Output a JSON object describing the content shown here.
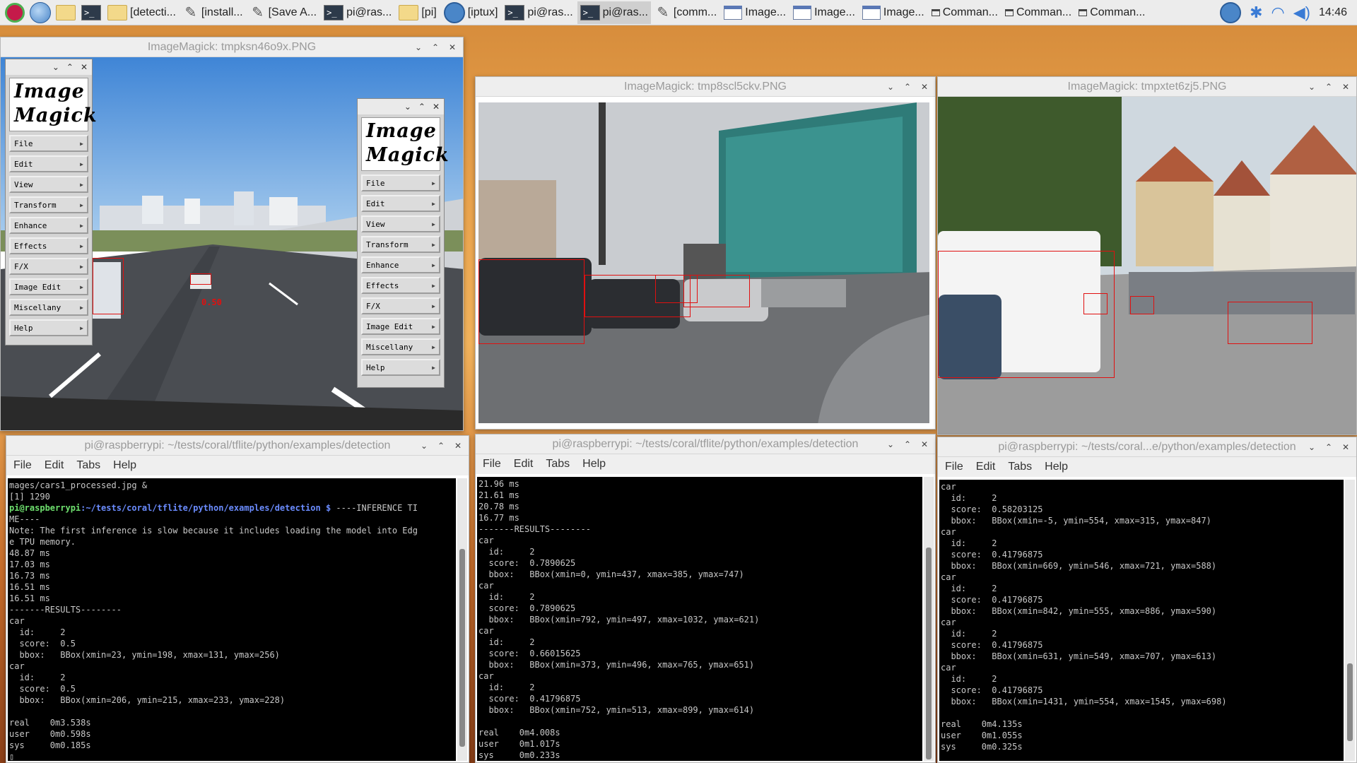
{
  "taskbar": {
    "tasks": [
      {
        "label": "[detecti...",
        "icon": "folder-icon"
      },
      {
        "label": "[install...",
        "icon": "pencil-icon"
      },
      {
        "label": "[Save A...",
        "icon": "pencil-icon"
      },
      {
        "label": "pi@ras...",
        "icon": "terminal-icon"
      },
      {
        "label": "[pi]",
        "icon": "folder-icon"
      },
      {
        "label": "[iptux]",
        "icon": "iptux-icon"
      },
      {
        "label": "pi@ras...",
        "icon": "terminal-icon"
      },
      {
        "label": "pi@ras...",
        "icon": "terminal-icon",
        "active": true
      },
      {
        "label": "[comm...",
        "icon": "pencil-icon"
      },
      {
        "label": "Image...",
        "icon": "window-icon"
      },
      {
        "label": "Image...",
        "icon": "window-icon"
      },
      {
        "label": "Image...",
        "icon": "window-icon"
      },
      {
        "label": "Comman...",
        "icon": "window-small-icon"
      },
      {
        "label": "Comman...",
        "icon": "window-small-icon"
      },
      {
        "label": "Comman...",
        "icon": "window-small-icon"
      }
    ],
    "clock": "14:46"
  },
  "image_windows": [
    {
      "title": "ImageMagick: tmpksn46o9x.PNG",
      "scores": [
        "0.50"
      ]
    },
    {
      "title": "ImageMagick: tmp8scl5ckv.PNG"
    },
    {
      "title": "ImageMagick: tmpxtet6zj5.PNG"
    }
  ],
  "imagemagick_menu": {
    "logo_line1": "Image",
    "logo_line2": "Magick",
    "buttons": [
      "File",
      "Edit",
      "View",
      "Transform",
      "Enhance",
      "Effects",
      "F/X",
      "Image Edit",
      "Miscellany",
      "Help"
    ]
  },
  "terminal_menu": [
    "File",
    "Edit",
    "Tabs",
    "Help"
  ],
  "terminals": [
    {
      "title": "pi@raspberrypi: ~/tests/coral/tflite/python/examples/detection",
      "prompt_user": "pi@raspberrypi",
      "prompt_path": ":~/tests/coral/tflite/python/examples/detection $",
      "prompt_rest": " ----INFERENCE TI",
      "lines_before": [
        "mages/cars1_processed.jpg &",
        "[1] 1290"
      ],
      "lines_after": [
        "ME----",
        "Note: The first inference is slow because it includes loading the model into Edg",
        "e TPU memory.",
        "48.87 ms",
        "17.03 ms",
        "16.73 ms",
        "16.51 ms",
        "16.51 ms",
        "-------RESULTS--------",
        "car",
        "  id:     2",
        "  score:  0.5",
        "  bbox:   BBox(xmin=23, ymin=198, xmax=131, ymax=256)",
        "car",
        "  id:     2",
        "  score:  0.5",
        "  bbox:   BBox(xmin=206, ymin=215, xmax=233, ymax=228)",
        "",
        "real    0m3.538s",
        "user    0m0.598s",
        "sys     0m0.185s",
        "▯"
      ]
    },
    {
      "title": "pi@raspberrypi: ~/tests/coral/tflite/python/examples/detection",
      "lines": [
        "21.96 ms",
        "21.61 ms",
        "20.78 ms",
        "16.77 ms",
        "-------RESULTS--------",
        "car",
        "  id:     2",
        "  score:  0.7890625",
        "  bbox:   BBox(xmin=0, ymin=437, xmax=385, ymax=747)",
        "car",
        "  id:     2",
        "  score:  0.7890625",
        "  bbox:   BBox(xmin=792, ymin=497, xmax=1032, ymax=621)",
        "car",
        "  id:     2",
        "  score:  0.66015625",
        "  bbox:   BBox(xmin=373, ymin=496, xmax=765, ymax=651)",
        "car",
        "  id:     2",
        "  score:  0.41796875",
        "  bbox:   BBox(xmin=752, ymin=513, xmax=899, ymax=614)",
        "",
        "real    0m4.008s",
        "user    0m1.017s",
        "sys     0m0.233s"
      ]
    },
    {
      "title": "pi@raspberrypi: ~/tests/coral...e/python/examples/detection",
      "lines": [
        "car",
        "  id:     2",
        "  score:  0.58203125",
        "  bbox:   BBox(xmin=-5, ymin=554, xmax=315, ymax=847)",
        "car",
        "  id:     2",
        "  score:  0.41796875",
        "  bbox:   BBox(xmin=669, ymin=546, xmax=721, ymax=588)",
        "car",
        "  id:     2",
        "  score:  0.41796875",
        "  bbox:   BBox(xmin=842, ymin=555, xmax=886, ymax=590)",
        "car",
        "  id:     2",
        "  score:  0.41796875",
        "  bbox:   BBox(xmin=631, ymin=549, xmax=707, ymax=613)",
        "car",
        "  id:     2",
        "  score:  0.41796875",
        "  bbox:   BBox(xmin=1431, ymin=554, xmax=1545, ymax=698)",
        "",
        "real    0m4.135s",
        "user    0m1.055s",
        "sys     0m0.325s"
      ]
    }
  ]
}
